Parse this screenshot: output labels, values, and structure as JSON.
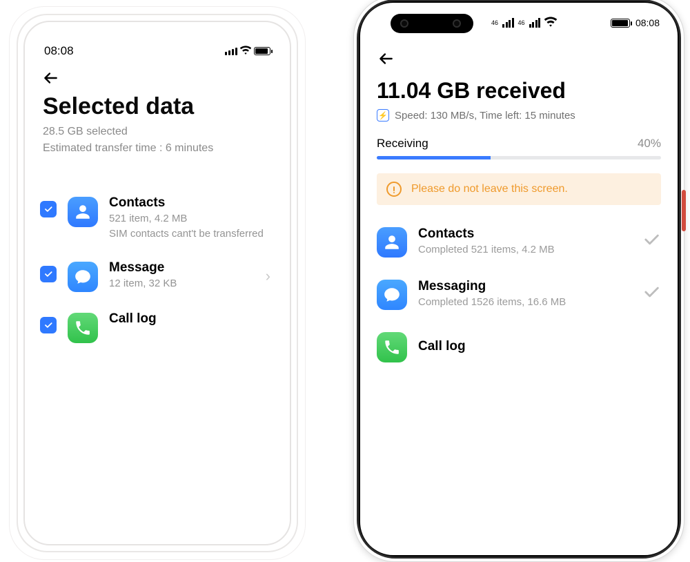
{
  "left": {
    "status_bar": {
      "time": "08:08"
    },
    "title": "Selected data",
    "selected_line": "28.5 GB selected",
    "estimate_line": "Estimated transfer time : 6 minutes",
    "items": [
      {
        "title": "Contacts",
        "sub": "521 item, 4.2 MB",
        "note": "SIM contacts cant't be transferred"
      },
      {
        "title": "Message",
        "sub": "12 item, 32 KB"
      },
      {
        "title": "Call log",
        "sub": ""
      }
    ]
  },
  "right": {
    "status_bar": {
      "time": "08:08"
    },
    "title": "11.04 GB received",
    "speed_line": "Speed: 130 MB/s, Time left: 15 minutes",
    "progress": {
      "label": "Receiving",
      "percent_text": "40%",
      "percent": 40
    },
    "warning": "Please do not leave this screen.",
    "items": [
      {
        "title": "Contacts",
        "sub": "Completed 521 items, 4.2 MB"
      },
      {
        "title": "Messaging",
        "sub": "Completed 1526 items, 16.6 MB"
      },
      {
        "title": "Call log",
        "sub": ""
      }
    ]
  }
}
